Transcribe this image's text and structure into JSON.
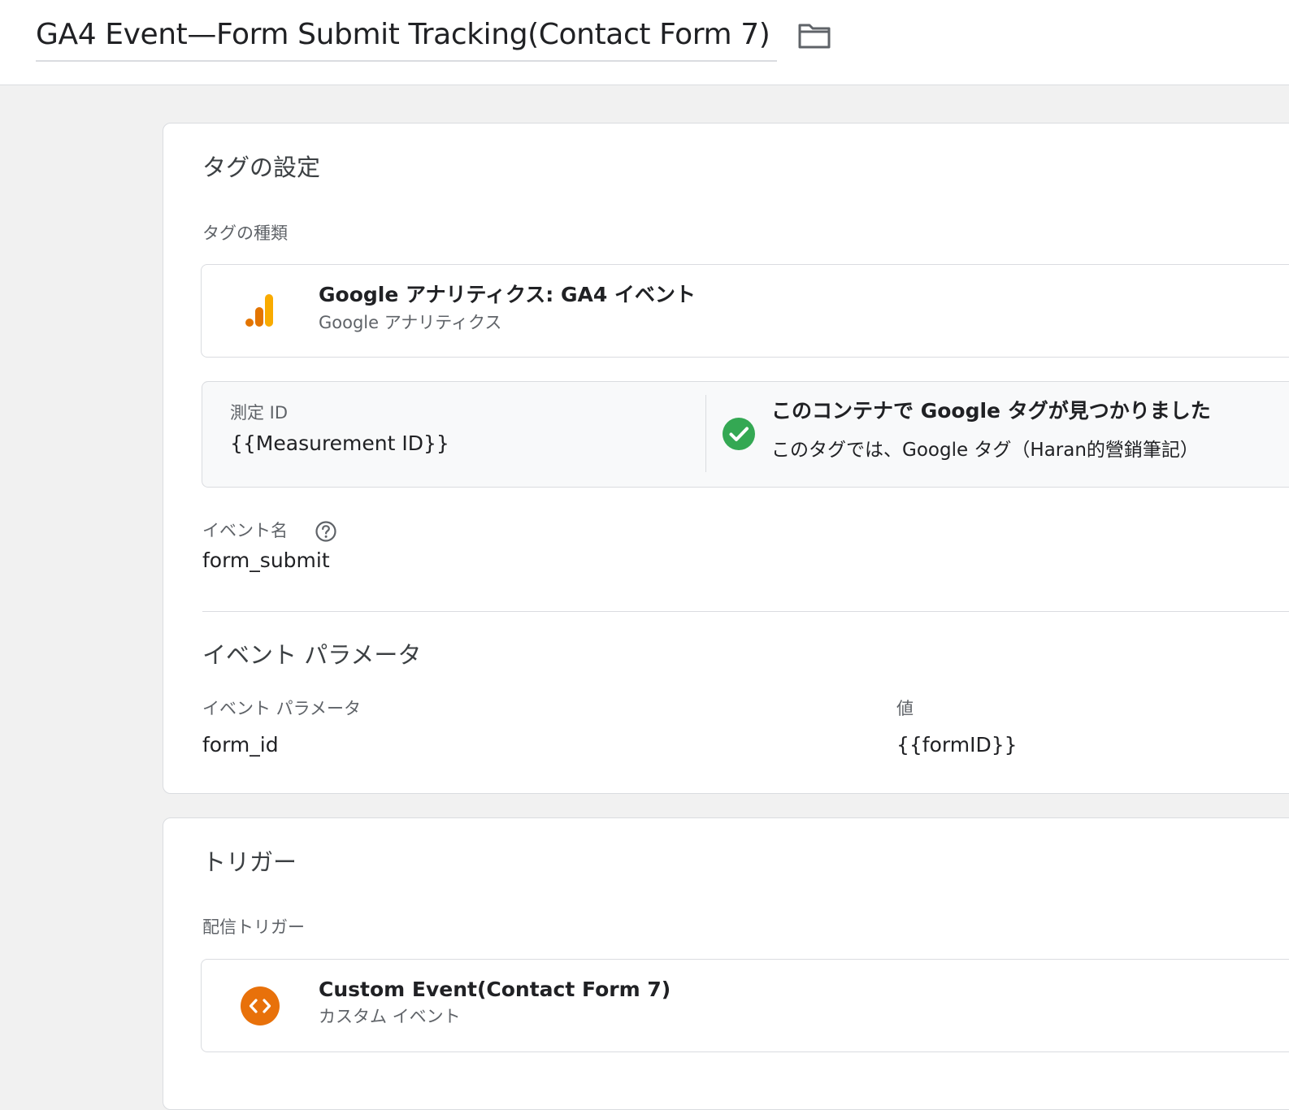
{
  "header": {
    "title": "GA4 Event—Form Submit Tracking(Contact Form 7)",
    "folder_icon": "folder-icon"
  },
  "tag_config": {
    "section_title": "タグの設定",
    "tag_type_label": "タグの種類",
    "tag_type": {
      "icon": "google-analytics-icon",
      "title": "Google アナリティクス: GA4 イベント",
      "subtitle": "Google アナリティクス"
    },
    "measurement": {
      "label": "測定 ID",
      "value": "{{Measurement ID}}",
      "status_icon": "check-circle-icon",
      "status_title": "このコンテナで Google タグが見つかりました",
      "status_desc": "このタグでは、Google タグ（Haran的營銷筆記）"
    },
    "event_name": {
      "label": "イベント名",
      "help_icon": "help-icon",
      "value": "form_submit"
    },
    "event_params": {
      "section_title": "イベント パラメータ",
      "col_param": "イベント パラメータ",
      "col_value": "値",
      "rows": [
        {
          "param": "form_id",
          "value": "{{formID}}"
        }
      ]
    }
  },
  "trigger": {
    "section_title": "トリガー",
    "firing_label": "配信トリガー",
    "items": [
      {
        "icon": "custom-event-code-icon",
        "title": "Custom Event(Contact Form 7)",
        "subtitle": "カスタム イベント"
      }
    ]
  },
  "colors": {
    "ga_orange_light": "#f9ab00",
    "ga_orange_dark": "#e37400",
    "success_green": "#34a853",
    "trigger_orange": "#e8710a",
    "border": "#dadce0",
    "page_bg": "#f1f1f1"
  }
}
